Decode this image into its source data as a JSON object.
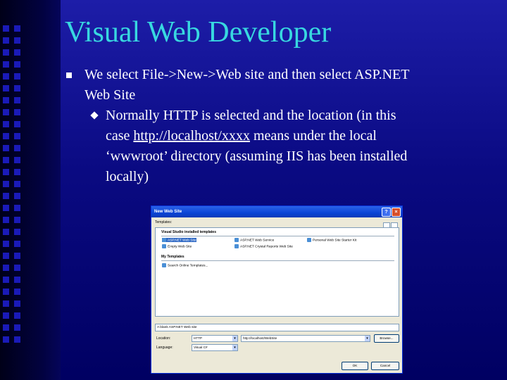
{
  "slide": {
    "title": "Visual Web Developer",
    "bullet1_line1": "We select File->New->Web site and then select ASP.NET",
    "bullet1_line2": "Web Site",
    "bullet2_line1": "Normally HTTP is selected and the location (in this",
    "bullet2_line2_pre": "case ",
    "bullet2_link": "http://localhost/xxxx",
    "bullet2_line2_post": " means under the local",
    "bullet2_line3": "‘wwwroot’ directory (assuming IIS has been installed",
    "bullet2_line4": "locally)",
    "colors": {
      "title": "#38d8e0",
      "background": "#0a0a82",
      "text": "#ffffff"
    }
  },
  "dialog": {
    "title": "New Web Site",
    "help_glyph": "?",
    "close_glyph": "×",
    "templates_label": "Templates:",
    "group_installed": "Visual Studio installed templates",
    "group_my": "My Templates",
    "templates": [
      "ASP.NET Web Site",
      "ASP.NET Web Service",
      "Personal Web Site Starter Kit",
      "Empty Web Site",
      "ASP.NET Crystal Reports Web Site"
    ],
    "my_templates": [
      "Search Online Templates..."
    ],
    "description": "A blank ASP.NET Web site",
    "location_label": "Location:",
    "location_type": "HTTP",
    "location_path": "http://localhost/WebSite",
    "browse_label": "Browse...",
    "language_label": "Language:",
    "language_value": "Visual C#",
    "ok_label": "OK",
    "cancel_label": "Cancel"
  }
}
